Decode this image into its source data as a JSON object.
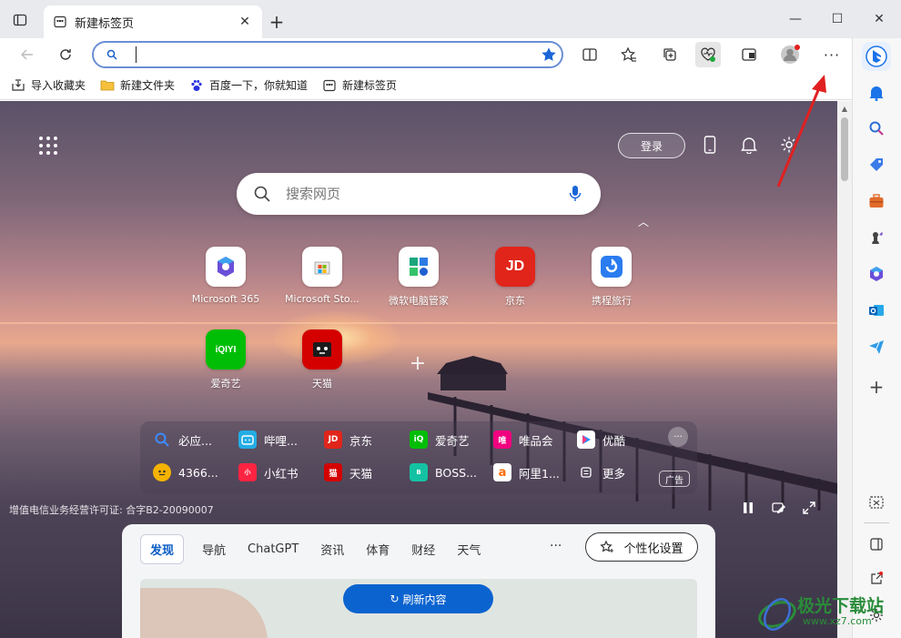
{
  "tab": {
    "title": "新建标签页",
    "close": "✕"
  },
  "window": {
    "minimize": "—",
    "maximize": "☐",
    "close": "✕"
  },
  "address": {
    "value": "",
    "placeholder": ""
  },
  "favorites": [
    {
      "label": "导入收藏夹",
      "icon": "import-favorites-icon"
    },
    {
      "label": "新建文件夹",
      "icon": "folder-icon"
    },
    {
      "label": "百度一下，你就知道",
      "icon": "baidu-paw-icon"
    },
    {
      "label": "新建标签页",
      "icon": "newtab-page-icon"
    }
  ],
  "header": {
    "login": "登录"
  },
  "search": {
    "placeholder": "搜索网页"
  },
  "tiles": [
    {
      "label": "Microsoft 365"
    },
    {
      "label": "Microsoft Sto..."
    },
    {
      "label": "微软电脑管家"
    },
    {
      "label": "京东"
    },
    {
      "label": "携程旅行"
    },
    {
      "label": "爱奇艺"
    },
    {
      "label": "天猫"
    }
  ],
  "quicklinks": [
    {
      "label": "必应...",
      "color": "#1a73e8",
      "glyph": "Q"
    },
    {
      "label": "哔哩...",
      "color": "#23ade5",
      "glyph": "b"
    },
    {
      "label": "京东",
      "color": "#e1251b",
      "glyph": "JD"
    },
    {
      "label": "爱奇艺",
      "color": "#00be06",
      "glyph": "iQ"
    },
    {
      "label": "唯品会",
      "color": "#f10180",
      "glyph": "唯"
    },
    {
      "label": "优酷",
      "color": "#1f8bff",
      "glyph": "▶"
    },
    {
      "label": "4366...",
      "color": "#f5b301",
      "glyph": "◕"
    },
    {
      "label": "小红书",
      "color": "#ff2442",
      "glyph": "小"
    },
    {
      "label": "天猫",
      "color": "#d40000",
      "glyph": "猫"
    },
    {
      "label": "BOSS...",
      "color": "#13c2a3",
      "glyph": "B"
    },
    {
      "label": "阿里1...",
      "color": "#ff6a00",
      "glyph": "a"
    },
    {
      "label": "更多",
      "color": "#888888",
      "glyph": "▤"
    }
  ],
  "quicklinks_more": "···",
  "ad": "广告",
  "license": "增值电信业务经营许可证: 合字B2-20090007",
  "feed": {
    "tabs": [
      "发现",
      "导航",
      "ChatGPT",
      "资讯",
      "体育",
      "财经",
      "天气"
    ],
    "more": "···",
    "personalize": "个性化设置",
    "refresh": "刷新内容"
  },
  "watermark": {
    "title": "极光下载站",
    "url": "www.xz7.com"
  },
  "colors": {
    "accent": "#0b63cf",
    "arrow": "#e02020"
  }
}
